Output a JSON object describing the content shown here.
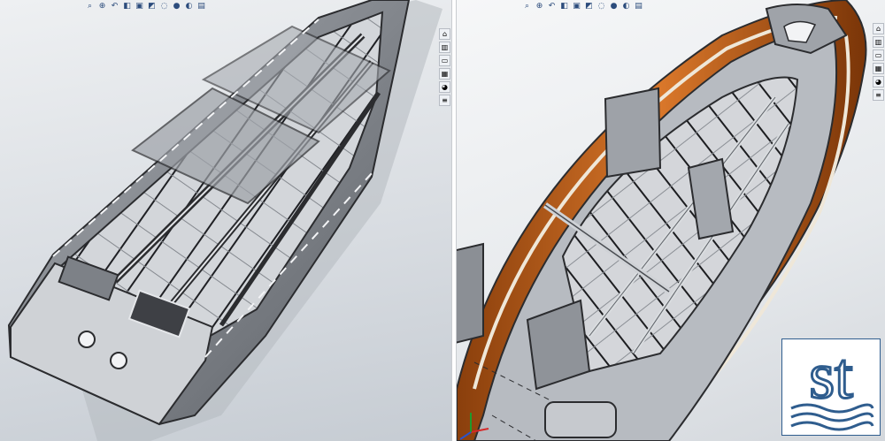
{
  "views": [
    {
      "id": "left",
      "hud_icons": [
        "zoom-fit-icon",
        "zoom-area-icon",
        "previous-view-icon",
        "section-view-icon",
        "view-orientation-icon",
        "display-style-icon",
        "hide-show-icon",
        "edit-appearance-icon",
        "apply-scene-icon",
        "view-settings-icon"
      ]
    },
    {
      "id": "right",
      "hud_icons": [
        "zoom-fit-icon",
        "zoom-area-icon",
        "previous-view-icon",
        "section-view-icon",
        "view-orientation-icon",
        "display-style-icon",
        "hide-show-icon",
        "edit-appearance-icon",
        "apply-scene-icon",
        "view-settings-icon"
      ]
    }
  ],
  "task_pane_icons": [
    "resources-icon",
    "design-library-icon",
    "file-explorer-icon",
    "view-palette-icon",
    "appearances-icon",
    "custom-properties-icon"
  ],
  "logo": {
    "text": "st",
    "color": "#2f5d8e"
  },
  "colors": {
    "hull_grey": "#8d9096",
    "frame_grey": "#c9ccd0",
    "deck_grey": "#b7bbc1",
    "fender_orange": "#c8691f",
    "dark_line": "#2b2c2f"
  }
}
